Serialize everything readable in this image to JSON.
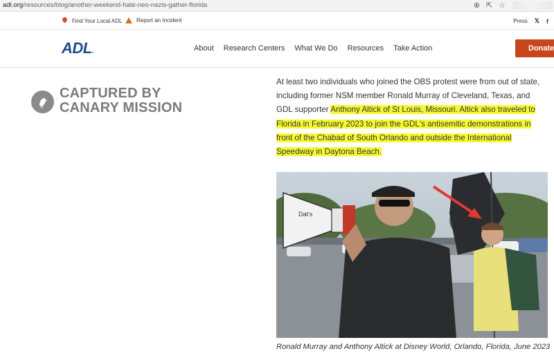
{
  "browser": {
    "url_domain": "adl.org",
    "url_path": "/resources/blog/another-weekend-hate-neo-nazis-gather-florida"
  },
  "utility": {
    "find_adl": "Find Your Local ADL",
    "report_incident": "Report an Incident",
    "press": "Press"
  },
  "nav": {
    "logo": "ADL",
    "items": [
      "About",
      "Research Centers",
      "What We Do",
      "Resources",
      "Take Action"
    ],
    "donate": "Donate"
  },
  "badge": {
    "line1": "CAPTURED BY",
    "line2": "CANARY MISSION"
  },
  "article": {
    "part1": "At least two individuals who joined the OBS protest were from out of state, including former NSM member Ronald Murray of Cleveland, Texas, and GDL supporter ",
    "highlight": "Anthony Altick of St Louis, Missouri. Altick also traveled to Florida in February 2023 to join the GDL's antisemitic demonstrations in front of the Chabad of South Orlando and outside the International Speedway in Daytona Beach."
  },
  "photo": {
    "megaphone_text": "Dat's",
    "caption": "Ronald Murray and Anthony Altick at Disney World, Orlando, Florida, June 2023"
  },
  "colors": {
    "brand_blue": "#1d4c8c",
    "donate_orange": "#c8461c",
    "highlight_yellow": "#f6f931",
    "arrow_red": "#e03a2f"
  }
}
